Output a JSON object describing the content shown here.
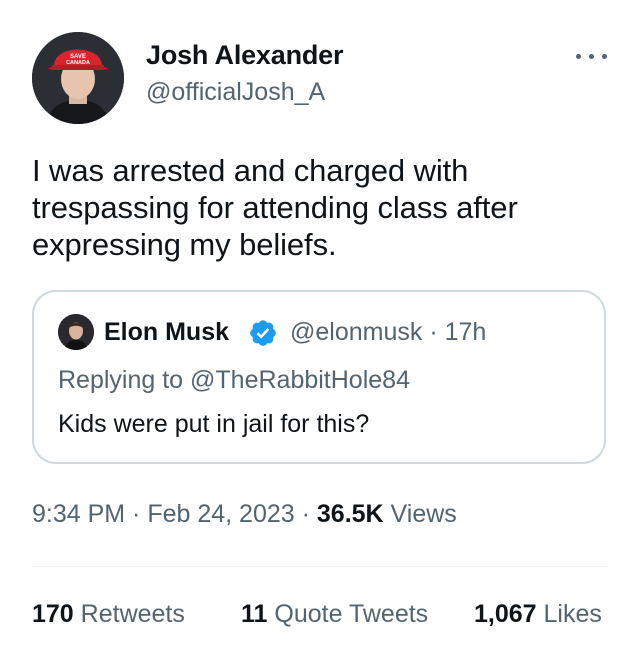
{
  "tweet": {
    "author": {
      "name": "Josh Alexander",
      "handle": "@officialJosh_A",
      "hat_text": "SAVE CANADA"
    },
    "text": "I was arrested and charged with trespassing for attending class after expressing my beliefs.",
    "more_icon": "more-horizontal-icon",
    "quoted": {
      "name": "Elon Musk",
      "handle_time": "@elonmusk · 17h",
      "verified_icon": "verified-badge-icon",
      "replying_prefix": "Replying to ",
      "replying_to": "@TheRabbitHole84",
      "text": "Kids were put in jail for this?"
    },
    "meta": {
      "time_date": "9:34 PM · Feb 24, 2023 · ",
      "views_count": "36.5K",
      "views_label": " Views"
    },
    "stats": {
      "retweets_count": "170",
      "retweets_label": " Retweets",
      "quotes_count": "11",
      "quotes_label": " Quote Tweets",
      "likes_count": "1,067",
      "likes_label": " Likes"
    }
  },
  "colors": {
    "secondary_text": "#536471",
    "primary_text": "#0f1419",
    "verified_blue": "#1d9bf0",
    "border": "#cfd9de"
  }
}
